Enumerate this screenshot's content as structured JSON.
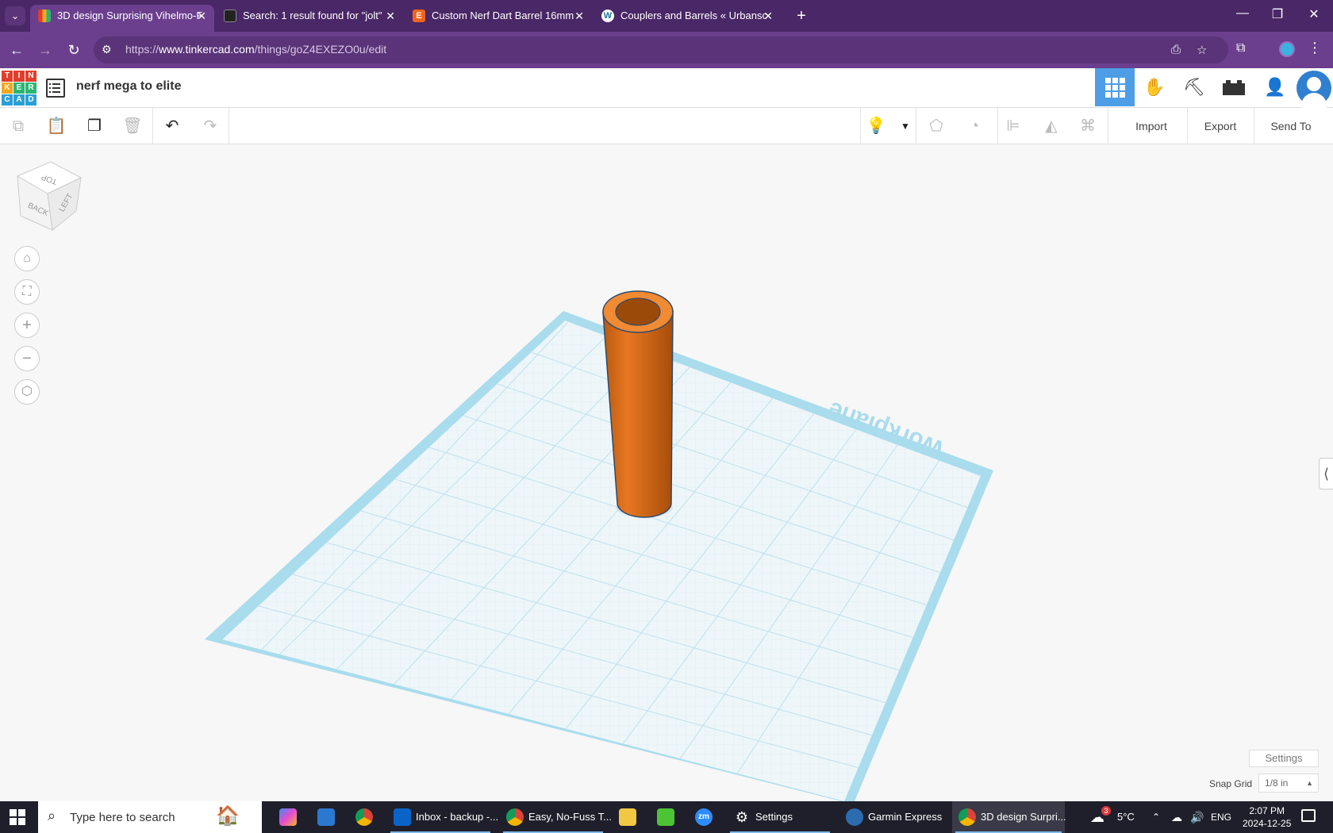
{
  "browser": {
    "tabs": [
      {
        "title": "3D design Surprising Vihelmo-F",
        "active": true
      },
      {
        "title": "Search: 1 result found for \"jolt\"",
        "active": false
      },
      {
        "title": "Custom Nerf Dart Barrel 16mm",
        "active": false
      },
      {
        "title": "Couplers and Barrels « Urbansc",
        "active": false
      }
    ],
    "url_prefix": "https://",
    "url_domain": "www.tinkercad.com",
    "url_path": "/things/goZ4EXEZO0u/edit"
  },
  "app": {
    "logo_letters": [
      "T",
      "I",
      "N",
      "K",
      "E",
      "R",
      "C",
      "A",
      "D"
    ],
    "design_title": "nerf mega to elite"
  },
  "toolbar": {
    "import_label": "Import",
    "export_label": "Export",
    "sendto_label": "Send To"
  },
  "viewcube": {
    "top_label": "TOP",
    "back_label": "BACK",
    "left_label": "LEFT"
  },
  "workplane": {
    "label": "Workplane",
    "settings_label": "Settings",
    "snap_grid_label": "Snap Grid",
    "snap_grid_value": "1/8 in"
  },
  "shape": {
    "type": "tube",
    "color": "#e87722"
  },
  "taskbar": {
    "search_placeholder": "Type here to search",
    "apps": [
      {
        "label": "Inbox - backup -..."
      },
      {
        "label": "Easy, No-Fuss T..."
      },
      {
        "label": "Settings"
      },
      {
        "label": "Garmin Express"
      },
      {
        "label": "3D design Surpri..."
      }
    ],
    "weather_temp": "5°C",
    "weather_badge": "3",
    "language": "ENG",
    "time": "2:07 PM",
    "date": "2024-12-25"
  }
}
